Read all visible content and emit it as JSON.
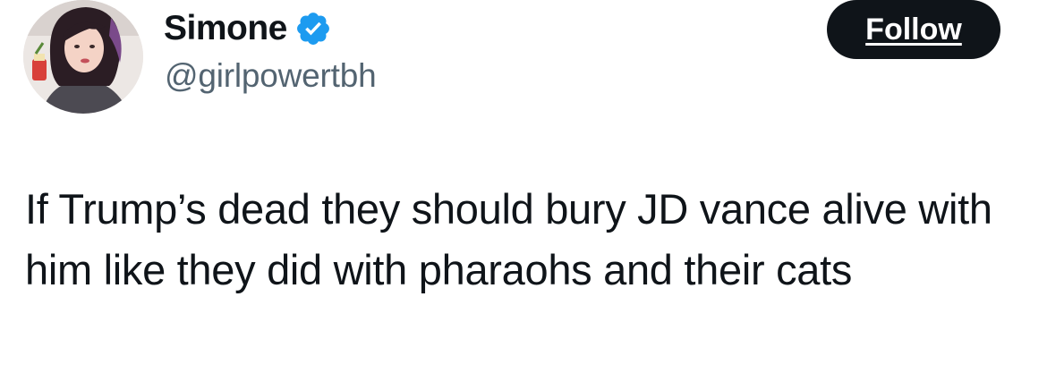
{
  "tweet": {
    "author": {
      "display_name": "Simone",
      "handle": "@girlpowertbh",
      "verified": true,
      "avatar_icon": "profile-photo"
    },
    "follow_label": "Follow",
    "text": "If Trump’s dead they should bury JD vance alive with him like they did with pharaohs and their cats"
  },
  "colors": {
    "text_primary": "#0f1419",
    "text_secondary": "#536471",
    "verified_badge": "#1d9bf0",
    "follow_button_bg": "#0f1419",
    "follow_button_text": "#ffffff"
  }
}
